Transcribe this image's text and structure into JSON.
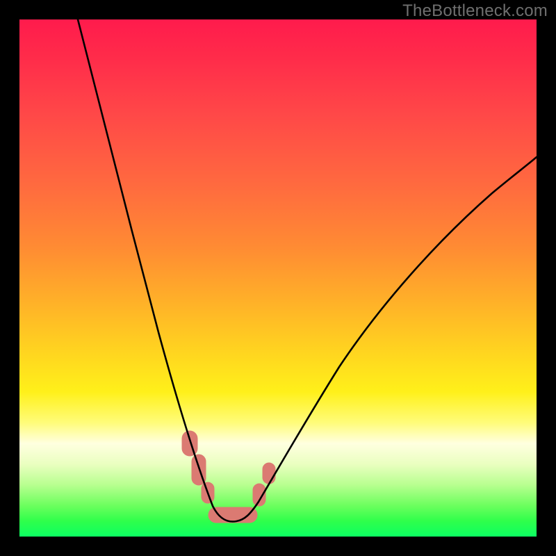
{
  "attribution": "TheBottleneck.com",
  "chart_data": {
    "type": "line",
    "title": "",
    "xlabel": "",
    "ylabel": "",
    "xlim": [
      0,
      100
    ],
    "ylim": [
      0,
      100
    ],
    "grid": false,
    "series": [
      {
        "name": "left-arm",
        "x": [
          11,
          15,
          19,
          23,
          27,
          30,
          33,
          35,
          37
        ],
        "y": [
          100,
          85,
          70,
          55,
          40,
          28,
          18,
          10,
          4
        ]
      },
      {
        "name": "right-arm",
        "x": [
          44,
          48,
          55,
          63,
          72,
          82,
          92,
          100
        ],
        "y": [
          4,
          10,
          20,
          32,
          44,
          56,
          66,
          74
        ]
      },
      {
        "name": "trough",
        "x": [
          37,
          40,
          44
        ],
        "y": [
          4,
          3,
          4
        ]
      }
    ],
    "annotations": [
      {
        "name": "pink-markers-left",
        "approx_x": [
          33,
          35,
          36,
          37
        ],
        "approx_y": [
          18,
          12,
          8,
          5
        ]
      },
      {
        "name": "pink-markers-right",
        "approx_x": [
          44,
          46,
          48
        ],
        "approx_y": [
          5,
          8,
          11
        ]
      },
      {
        "name": "pink-trough-bar",
        "approx_x_range": [
          37,
          44
        ],
        "approx_y": 3
      }
    ],
    "background_gradient": {
      "direction": "vertical",
      "stops": [
        {
          "pos": 0.0,
          "color": "#ff1b4c"
        },
        {
          "pos": 0.45,
          "color": "#ff8b33"
        },
        {
          "pos": 0.72,
          "color": "#fff01a"
        },
        {
          "pos": 0.88,
          "color": "#b8ff90"
        },
        {
          "pos": 1.0,
          "color": "#0cff62"
        }
      ]
    }
  }
}
